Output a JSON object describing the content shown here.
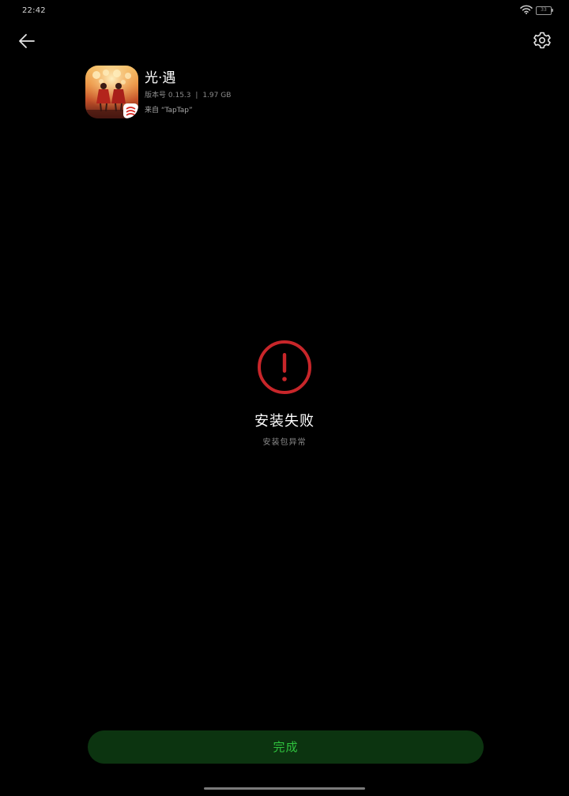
{
  "status_bar": {
    "time": "22:42",
    "battery": "33",
    "wifi_icon": "wifi-icon",
    "battery_icon": "battery-icon"
  },
  "toolbar": {
    "back_icon": "arrow-left-icon",
    "settings_icon": "gear-icon"
  },
  "app": {
    "name": "光·遇",
    "version_label": "版本号",
    "version": "0.15.3",
    "separator": "|",
    "size": "1.97 GB",
    "source": "来自 “TapTap”",
    "icon": "sky-app-icon"
  },
  "result": {
    "icon": "error-exclamation-icon",
    "title": "安装失败",
    "detail": "安装包异常",
    "color": "#c8262a"
  },
  "actions": {
    "done_label": "完成",
    "accent": "#2fc23e",
    "button_bg": "#0c3410"
  }
}
